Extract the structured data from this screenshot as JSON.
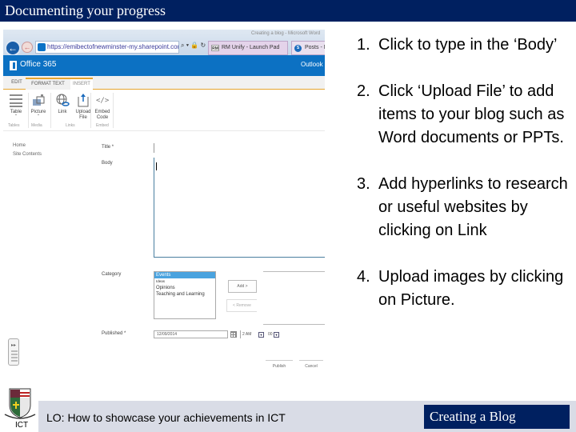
{
  "slide": {
    "title": "Documenting your progress",
    "footer": {
      "lo_prefix": "LO:",
      "lo_text": " How to showcase your achievements in ICT",
      "badge": "Creating a Blog",
      "crest_label": "ICT"
    },
    "steps": [
      {
        "num": "1.",
        "text": "Click to type in the ‘Body’"
      },
      {
        "num": "2.",
        "text": "Click ‘Upload File’ to add items to your blog such as Word documents or PPTs."
      },
      {
        "num": "3.",
        "text": "Add hyperlinks to research or useful websites by clicking on Link"
      },
      {
        "num": "4.",
        "text": "Upload images by clicking on Picture."
      }
    ],
    "colors": {
      "navy": "#002060",
      "office_blue": "#0c71c3",
      "ribbon_accent": "#e6a530",
      "footer_band": "#d9dce6"
    }
  },
  "screenshot": {
    "browser": {
      "back_icon": "←",
      "forward_icon": "←",
      "address": "https://emibectofnewminster-my.sharepoint.com/pe",
      "address_tools": "⌕ ▾ 🔒 ↻",
      "window_title": "Creating a blog - Microsoft Word",
      "tabs": [
        {
          "favicon": "RM",
          "label": "RM Unify - Launch Pad"
        },
        {
          "favicon": "S",
          "label": "Posts - New Item"
        }
      ]
    },
    "suite_bar": {
      "brand": "Office 365",
      "app": "Outlook"
    },
    "ribbon": {
      "tabs": [
        "EDIT",
        "FORMAT TEXT",
        "INSERT"
      ],
      "buttons": [
        {
          "label": "Table",
          "sub": "ˇ",
          "icon": "table-icon"
        },
        {
          "label": "Picture",
          "sub": "ˇ",
          "icon": "picture-icon"
        },
        {
          "label": "Link",
          "sub": "",
          "icon": "link-icon"
        },
        {
          "label": "Upload",
          "sub": "File",
          "icon": "upload-file-icon"
        },
        {
          "label": "Embed",
          "sub": "Code",
          "icon": "embed-code-icon"
        }
      ],
      "groups": [
        "Tables",
        "Media",
        "Links",
        "Embed"
      ]
    },
    "nav": [
      "Home",
      "Site Contents"
    ],
    "form": {
      "title_label": "Title *",
      "body_label": "Body",
      "category_label": "Category",
      "categories": [
        "Events",
        "Ideas",
        "Opinions",
        "Teaching and Learning"
      ],
      "selected_category": "Events",
      "add_button": "Add >",
      "remove_button": "< Remove",
      "published_label": "Published *",
      "date_value": "12/09/2014",
      "hour_value": "2 AM",
      "minute_value": "00",
      "publish_button": "Publish",
      "cancel_button": "Cancel"
    }
  }
}
